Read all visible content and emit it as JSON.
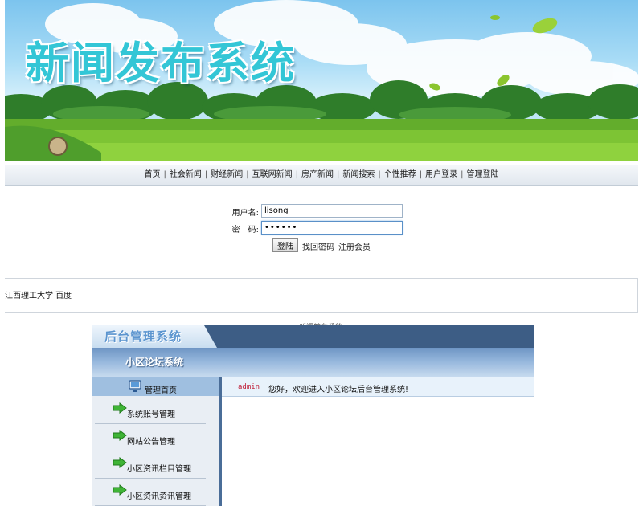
{
  "banner": {
    "title": "新闻发布系统"
  },
  "nav": {
    "items": [
      "首页",
      "社会新闻",
      "财经新闻",
      "互联网新闻",
      "房产新闻",
      "新闻搜索",
      "个性推荐",
      "用户登录",
      "管理登陆"
    ],
    "separator": "|"
  },
  "login": {
    "username_label": "用户名:",
    "username_value": "lisong",
    "password_label": "密　码:",
    "password_value": "••••••",
    "login_button": "登陆",
    "recover_link": "找回密码",
    "register_link": "注册会员"
  },
  "footer": {
    "links_text": "江西理工大学 百度",
    "caption": "新闻发布系统"
  },
  "admin": {
    "logo": "后台管理系统",
    "subtitle": "小区论坛系统",
    "sidebar": [
      {
        "label": "管理首页"
      },
      {
        "label": "系统账号管理"
      },
      {
        "label": "网站公告管理"
      },
      {
        "label": "小区资讯栏目管理"
      },
      {
        "label": "小区资讯资讯管理"
      }
    ],
    "welcome_user": "admin",
    "welcome_text": "您好，欢迎进入小区论坛后台管理系统!"
  },
  "colors": {
    "banner_title": "#33c6d6",
    "admin_topbar": "#3d5d85",
    "admin_username": "#c0203a"
  }
}
